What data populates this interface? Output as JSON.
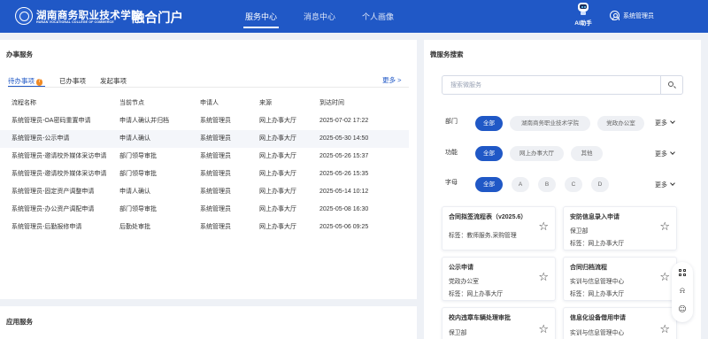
{
  "header": {
    "school_name_cn": "湖南商务职业技术学院",
    "school_name_en": "HUNAN VOCATIONAL COLLEGE OF COMMERCE",
    "portal_title": "融合门户",
    "nav": [
      "服务中心",
      "消息中心",
      "个人画像"
    ],
    "active_nav": "服务中心",
    "ai_label": "AI助手",
    "user_label": "系统管理员",
    "brand_color": "#2058c6"
  },
  "office": {
    "title": "办事服务",
    "tabs": [
      "待办事项",
      "已办事项",
      "发起事项"
    ],
    "todo_badge": "7",
    "more": "更多",
    "columns": [
      "流程名称",
      "当前节点",
      "申请人",
      "来源",
      "到达时间"
    ],
    "rows": [
      [
        "系统管理员-OA密码重置申请",
        "申请人确认并归档",
        "系统管理员",
        "网上办事大厅",
        "2025-07-02 17:22"
      ],
      [
        "系统管理员-公示申请",
        "申请人确认",
        "系统管理员",
        "网上办事大厅",
        "2025-05-30 14:50"
      ],
      [
        "系统管理员-邀请校外媒体采访申请",
        "部门领导审批",
        "系统管理员",
        "网上办事大厅",
        "2025-05-26 15:37"
      ],
      [
        "系统管理员-邀请校外媒体采访申请",
        "部门领导审批",
        "系统管理员",
        "网上办事大厅",
        "2025-05-26 15:35"
      ],
      [
        "系统管理员-固定资产调整申请",
        "申请人确认",
        "系统管理员",
        "网上办事大厅",
        "2025-05-14 10:12"
      ],
      [
        "系统管理员-办公资产调配申请",
        "部门领导审批",
        "系统管理员",
        "网上办事大厅",
        "2025-05-08 16:30"
      ],
      [
        "系统管理员-后勤报修申请",
        "后勤处审批",
        "系统管理员",
        "网上办事大厅",
        "2025-05-06 09:25"
      ]
    ]
  },
  "apps": {
    "title": "应用服务"
  },
  "micro": {
    "title": "微服务搜索",
    "search_placeholder": "搜索微服务",
    "filters": {
      "dept": {
        "label": "部门",
        "chips": [
          "全部",
          "湖南商务职业技术学院",
          "党政办公室"
        ],
        "more": "更多"
      },
      "func": {
        "label": "功能",
        "chips": [
          "全部",
          "网上办事大厅",
          "其他"
        ],
        "more": "更多"
      },
      "letter": {
        "label": "字母",
        "chips": [
          "全部",
          "A",
          "B",
          "C",
          "D"
        ],
        "more": "更多"
      }
    },
    "cards": [
      {
        "title": "合同拟签流程表（v2025.6）",
        "lines": [
          "标签：教师服务,采购管理"
        ]
      },
      {
        "title": "安防信息录入申请",
        "lines": [
          "保卫部",
          "标签：网上办事大厅"
        ]
      },
      {
        "title": "公示申请",
        "lines": [
          "党政办公室",
          "标签：网上办事大厅"
        ]
      },
      {
        "title": "合同归档流程",
        "lines": [
          "实训与信息管理中心",
          "标签：网上办事大厅"
        ]
      },
      {
        "title": "校内违章车辆处理审批",
        "lines": [
          "保卫部"
        ]
      },
      {
        "title": "信息化设备借用申请",
        "lines": [
          "实训与信息管理中心"
        ]
      }
    ]
  },
  "float_tools": [
    "grid-icon",
    "bell-icon",
    "smile-icon"
  ]
}
